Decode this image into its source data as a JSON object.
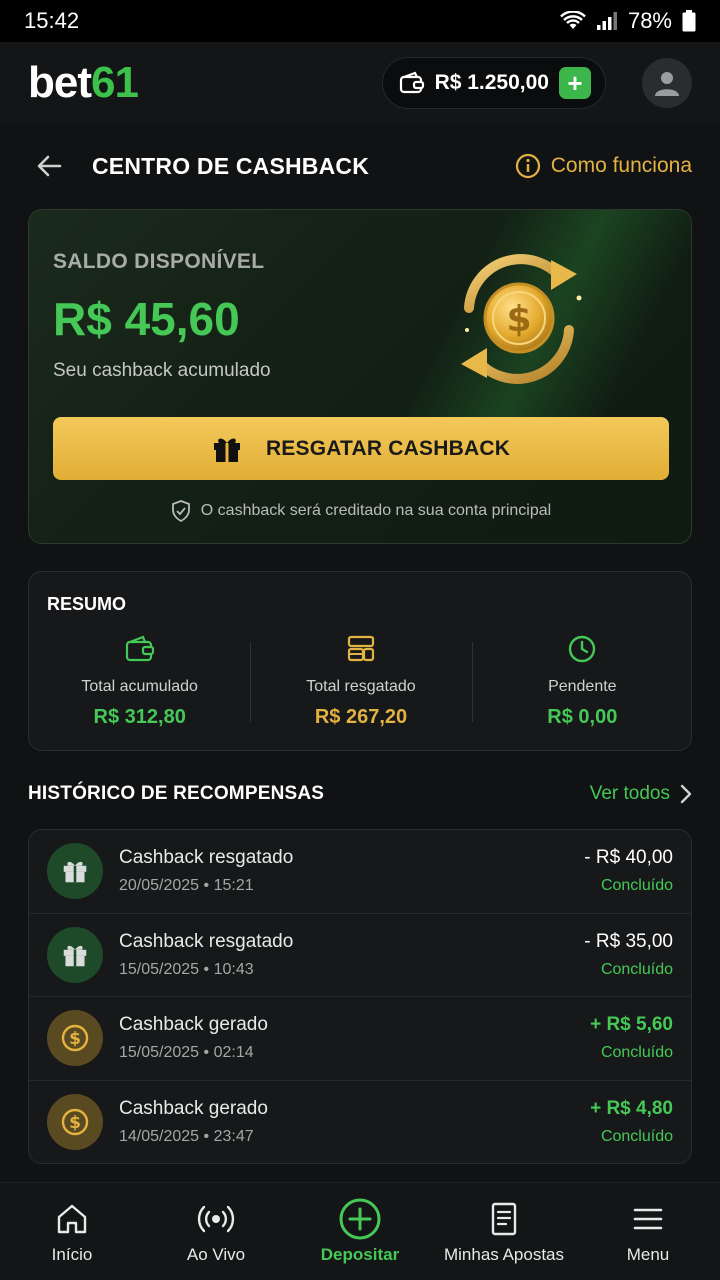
{
  "status_bar": {
    "time": "15:42",
    "battery": "78%"
  },
  "app": {
    "logo_white": "bet",
    "logo_green": "61",
    "wallet_balance": "R$ 1.250,00"
  },
  "page": {
    "title": "CENTRO DE CASHBACK",
    "help_label": "Como funciona"
  },
  "hero": {
    "label": "SALDO DISPONÍVEL",
    "amount": "R$ 45,60",
    "subtitle": "Seu cashback acumulado",
    "button_label": "RESGATAR CASHBACK",
    "note": "O cashback será creditado na sua conta principal"
  },
  "summary": {
    "title": "RESUMO",
    "items": [
      {
        "label": "Total acumulado",
        "value": "R$ 312,80",
        "icon": "wallet-icon",
        "color": "#45c856"
      },
      {
        "label": "Total resgatado",
        "value": "R$ 267,20",
        "icon": "stack-icon",
        "color": "#e3b341"
      },
      {
        "label": "Pendente",
        "value": "R$ 0,00",
        "icon": "clock-icon",
        "color": "#45c856"
      }
    ]
  },
  "history": {
    "title": "HISTÓRICO DE RECOMPENSAS",
    "see_all": "Ver todos",
    "rows": [
      {
        "title": "Cashback resgatado",
        "date": "20/05/2025 • 15:21",
        "amount": "- R$ 40,00",
        "status": "Concluído",
        "icon": "gift-icon",
        "kind": "neg"
      },
      {
        "title": "Cashback resgatado",
        "date": "15/05/2025 • 10:43",
        "amount": "- R$ 35,00",
        "status": "Concluído",
        "icon": "gift-icon",
        "kind": "neg"
      },
      {
        "title": "Cashback gerado",
        "date": "15/05/2025 • 02:14",
        "amount": "+ R$ 5,60",
        "status": "Concluído",
        "icon": "coin-icon",
        "kind": "pos"
      },
      {
        "title": "Cashback gerado",
        "date": "14/05/2025 • 23:47",
        "amount": "+ R$ 4,80",
        "status": "Concluído",
        "icon": "coin-icon",
        "kind": "pos"
      }
    ]
  },
  "nav": [
    {
      "label": "Início",
      "icon": "home-icon"
    },
    {
      "label": "Ao Vivo",
      "icon": "live-icon"
    },
    {
      "label": "Depositar",
      "icon": "plus-circle-icon",
      "active": true
    },
    {
      "label": "Minhas Apostas",
      "icon": "receipt-icon"
    },
    {
      "label": "Menu",
      "icon": "hamburger-icon"
    }
  ],
  "colors": {
    "accent_green": "#45c856",
    "accent_gold": "#e3b341",
    "background": "#111213"
  }
}
